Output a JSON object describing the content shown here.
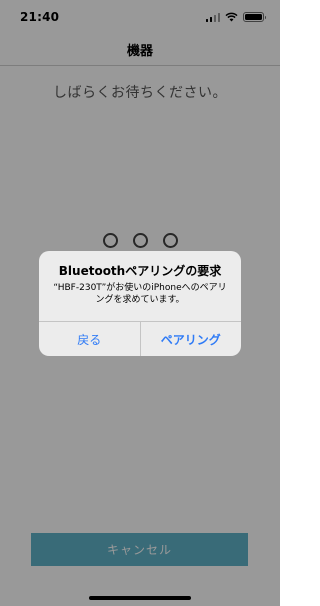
{
  "status_bar": {
    "time": "21:40"
  },
  "nav": {
    "title": "機器"
  },
  "main": {
    "wait_message": "しばらくお待ちください。",
    "cancel_label": "キャンセル"
  },
  "alert": {
    "title": "Bluetoothペアリングの要求",
    "message": "“HBF-230T”がお使いのiPhoneへのペアリングを求めています。",
    "back_label": "戻る",
    "pair_label": "ペアリング"
  },
  "colors": {
    "accent": "#2f7bf6",
    "cancel_button": "#5fb3c9"
  }
}
